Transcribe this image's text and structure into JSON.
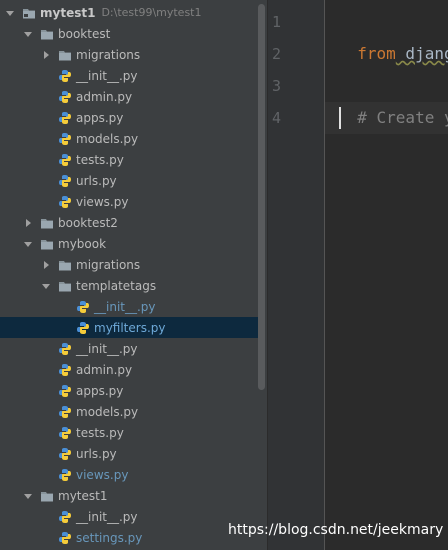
{
  "tree": {
    "root": {
      "name": "mytest1",
      "path": "D:\\test99\\mytest1"
    },
    "rows": [
      {
        "kind": "root",
        "label": "mytest1",
        "expanded": true
      },
      {
        "kind": "folder",
        "label": "booktest",
        "expanded": true
      },
      {
        "kind": "folder",
        "label": "migrations",
        "expanded": false
      },
      {
        "kind": "file",
        "label": "__init__.py"
      },
      {
        "kind": "file",
        "label": "admin.py"
      },
      {
        "kind": "file",
        "label": "apps.py"
      },
      {
        "kind": "file",
        "label": "models.py"
      },
      {
        "kind": "file",
        "label": "tests.py"
      },
      {
        "kind": "file",
        "label": "urls.py"
      },
      {
        "kind": "file",
        "label": "views.py"
      },
      {
        "kind": "folder",
        "label": "booktest2",
        "expanded": false
      },
      {
        "kind": "folder",
        "label": "mybook",
        "expanded": true
      },
      {
        "kind": "folder",
        "label": "migrations",
        "expanded": false
      },
      {
        "kind": "folder",
        "label": "templatetags",
        "expanded": true
      },
      {
        "kind": "file",
        "label": "__init__.py",
        "status": "added"
      },
      {
        "kind": "file",
        "label": "myfilters.py",
        "status": "added",
        "selected": true
      },
      {
        "kind": "file",
        "label": "__init__.py"
      },
      {
        "kind": "file",
        "label": "admin.py"
      },
      {
        "kind": "file",
        "label": "apps.py"
      },
      {
        "kind": "file",
        "label": "models.py"
      },
      {
        "kind": "file",
        "label": "tests.py"
      },
      {
        "kind": "file",
        "label": "urls.py"
      },
      {
        "kind": "file",
        "label": "views.py",
        "status": "added"
      },
      {
        "kind": "folder",
        "label": "mytest1",
        "expanded": true
      },
      {
        "kind": "file",
        "label": "__init__.py"
      },
      {
        "kind": "file",
        "label": "settings.py",
        "status": "added"
      }
    ]
  },
  "editor": {
    "line_numbers": [
      "1",
      "2",
      "3",
      "4"
    ],
    "lines": [
      {
        "keyword": "from",
        "text": " djang"
      },
      {
        "keyword": "",
        "text": ""
      },
      {
        "keyword": "",
        "text": "# Create y"
      },
      {
        "keyword": "",
        "text": ""
      }
    ],
    "current_line": 4
  },
  "watermark": "https://blog.csdn.net/jeekmary",
  "colors": {
    "panel_bg": "#3c3f41",
    "editor_bg": "#2b2b2b",
    "selection_bg": "#0d293e",
    "added_file": "#6897bb",
    "keyword": "#cc7832",
    "comment": "#808080"
  }
}
